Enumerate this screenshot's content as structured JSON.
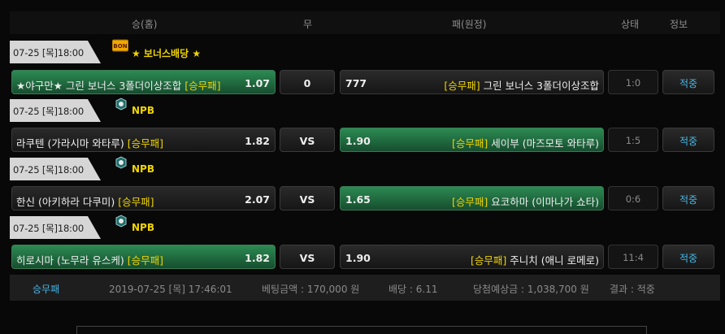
{
  "header": {
    "home": "승(홈)",
    "draw": "무",
    "away": "패(원정)",
    "status": "상태",
    "info": "정보"
  },
  "games": [
    {
      "date": "07-25 [목]18:00",
      "league": "★ 보너스배당 ★",
      "league_icon": "bonus-icon",
      "home": {
        "name": "★야구만★ 그린 보너스 3폴더이상조합 ",
        "tag": "[승무패]",
        "odds": "1.07"
      },
      "draw": "0",
      "away": {
        "odds": "777",
        "tag": "[승무패]",
        "name": " 그린 보너스 3폴더이상조합"
      },
      "score": "1:0",
      "result": "적중"
    },
    {
      "date": "07-25 [목]18:00",
      "league": "NPB",
      "league_icon": "japan-baseball-icon",
      "home": {
        "name": "라쿠텐 (가라시마 와타루) ",
        "tag": "[승무패]",
        "odds": "1.82"
      },
      "draw": "VS",
      "away": {
        "odds": "1.90",
        "tag": "[승무패]",
        "name": " 세이부 (마즈모토 와타루)"
      },
      "score": "1:5",
      "result": "적중"
    },
    {
      "date": "07-25 [목]18:00",
      "league": "NPB",
      "league_icon": "japan-baseball-icon",
      "home": {
        "name": "한신 (아키하라 다쿠미) ",
        "tag": "[승무패]",
        "odds": "2.07"
      },
      "draw": "VS",
      "away": {
        "odds": "1.65",
        "tag": "[승무패]",
        "name": " 요코하마 (이마나가 쇼타)"
      },
      "score": "0:6",
      "result": "적중"
    },
    {
      "date": "07-25 [목]18:00",
      "league": "NPB",
      "league_icon": "japan-baseball-icon",
      "home": {
        "name": "히로시마 (노무라 유스케) ",
        "tag": "[승무패]",
        "odds": "1.82"
      },
      "draw": "VS",
      "away": {
        "odds": "1.90",
        "tag": "[승무패]",
        "name": " 주니치 (애니 로메로)"
      },
      "score": "11:4",
      "result": "적중"
    }
  ],
  "summary": {
    "type": "승무패",
    "datetime": "2019-07-25 [목] 17:46:01",
    "bet_amount": "베팅금액 : 170,000 원",
    "odds": "배당 : 6.11",
    "expected_win": "당첨예상금 : 1,038,700 원",
    "result": "결과 : 적중"
  }
}
